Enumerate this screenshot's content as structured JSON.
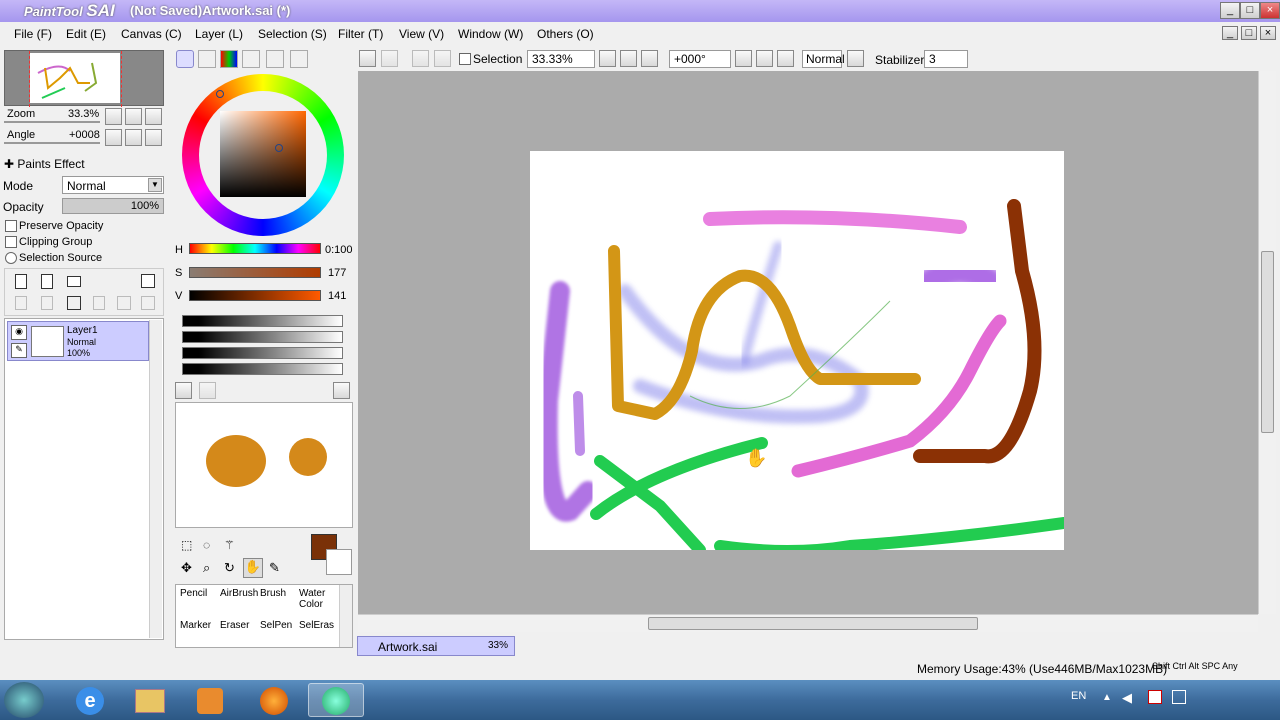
{
  "window": {
    "app_logo_prefix": "PaintTool",
    "app_logo_name": "SAI",
    "title": "(Not Saved)Artwork.sai (*)"
  },
  "menu": [
    "File (F)",
    "Edit (E)",
    "Canvas (C)",
    "Layer (L)",
    "Selection (S)",
    "Filter (T)",
    "View (V)",
    "Window (W)",
    "Others (O)"
  ],
  "navigator": {
    "zoom_label": "Zoom",
    "zoom_value": "33.3%",
    "angle_label": "Angle",
    "angle_value": "+0008"
  },
  "paints_effect": {
    "header": "Paints Effect",
    "mode_label": "Mode",
    "mode_value": "Normal",
    "opacity_label": "Opacity",
    "opacity_value": "100%"
  },
  "layer_options": {
    "preserve_opacity": "Preserve Opacity",
    "clipping_group": "Clipping Group",
    "selection_source": "Selection Source"
  },
  "layers": [
    {
      "name": "Layer1",
      "mode": "Normal",
      "opacity": "100%"
    }
  ],
  "color": {
    "h_label": "H",
    "h_value": "0:100",
    "s_label": "S",
    "s_value": "177",
    "v_label": "V",
    "v_value": "141",
    "foreground": "#7a3108",
    "background": "#ffffff"
  },
  "tools": [
    {
      "label": "Pencil"
    },
    {
      "label": "AirBrush"
    },
    {
      "label": "Brush"
    },
    {
      "label": "Water Color"
    },
    {
      "label": "Marker"
    },
    {
      "label": "Eraser"
    },
    {
      "label": "SelPen"
    },
    {
      "label": "SelEras"
    }
  ],
  "toolbar": {
    "selection_label": "Selection",
    "zoom": "33.33%",
    "angle": "+000°",
    "blend": "Normal",
    "stabilizer_label": "Stabilizer",
    "stabilizer_value": "3"
  },
  "document_tab": {
    "name": "Artwork.sai",
    "zoom": "33%"
  },
  "status": {
    "memory": "Memory Usage:43% (Use446MB/Max1023MB)",
    "keys": [
      "Shift",
      "Ctrl",
      "Alt",
      "SPC",
      "Any"
    ]
  },
  "taskbar": {
    "language": "EN"
  }
}
